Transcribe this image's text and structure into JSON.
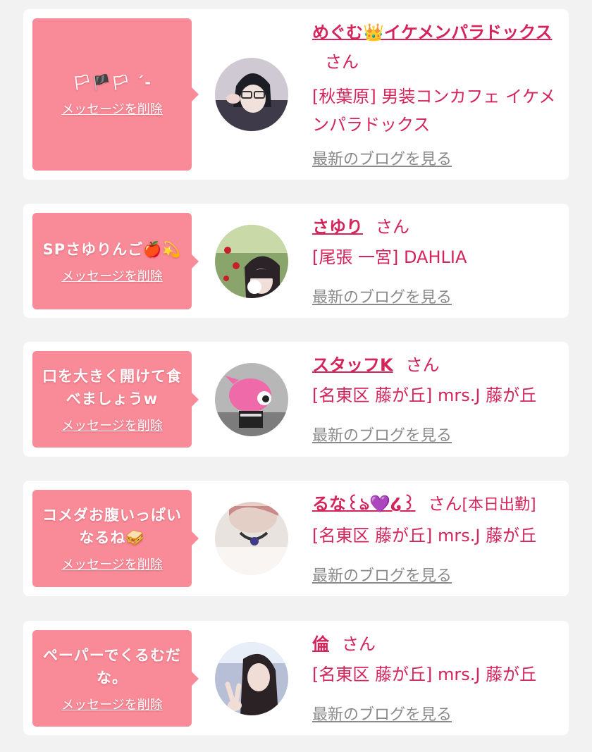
{
  "delete_label": "メッセージを削除",
  "blog_label": "最新のブログを見る",
  "honorific": "さん",
  "colors": {
    "accent": "#d4245a",
    "bubble": "#f98a97",
    "link_gray": "#8a8a8a"
  },
  "items": [
    {
      "message": "🏳🏴🏳 ˊ-",
      "name": "めぐむ👑イケメンパラドックス",
      "extra": "",
      "shop": "[秋葉原] 男装コンカフェ イケメンパラドックス"
    },
    {
      "message": "SPさゆりんご🍎💫",
      "name": "さゆり",
      "extra": "",
      "shop": "[尾張 一宮] DAHLIA"
    },
    {
      "message": "口を大きく開けて食べましょうw",
      "name": "スタッフK",
      "extra": "",
      "shop": "[名東区 藤が丘] mrs.J 藤が丘"
    },
    {
      "message": "コメダお腹いっぱいなるね🥪",
      "name": "るな꒰ঌ💜໒꒱",
      "extra": "[本日出勤]",
      "shop": "[名東区 藤が丘] mrs.J 藤が丘"
    },
    {
      "message": "ペーパーでくるむだな。",
      "name": "倫",
      "extra": "",
      "shop": "[名東区 藤が丘] mrs.J 藤が丘"
    }
  ]
}
